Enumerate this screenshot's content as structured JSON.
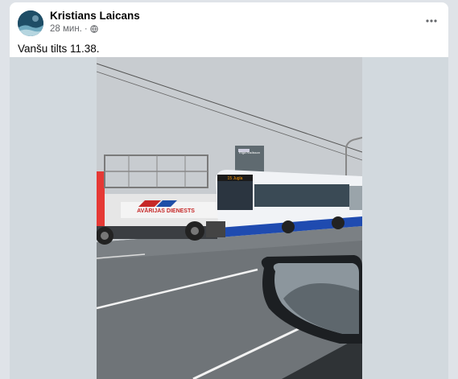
{
  "post": {
    "author": "Kristians Laicans",
    "time": "28 мин.",
    "separator": "·",
    "audience_icon": "globe-icon",
    "more_icon": "more-options-icon",
    "caption": "Vanšu tilts 11.38."
  },
  "photo": {
    "truck_text": "AVĀRIJAS DIENESTS",
    "building_sign": "Rīga Radisson",
    "bus_destination": "15 Jugla"
  },
  "colors": {
    "page_bg": "#dfe3e8",
    "card_bg": "#ffffff",
    "media_bg": "#d2d9de",
    "text_primary": "#050505",
    "text_secondary": "#65676b"
  }
}
